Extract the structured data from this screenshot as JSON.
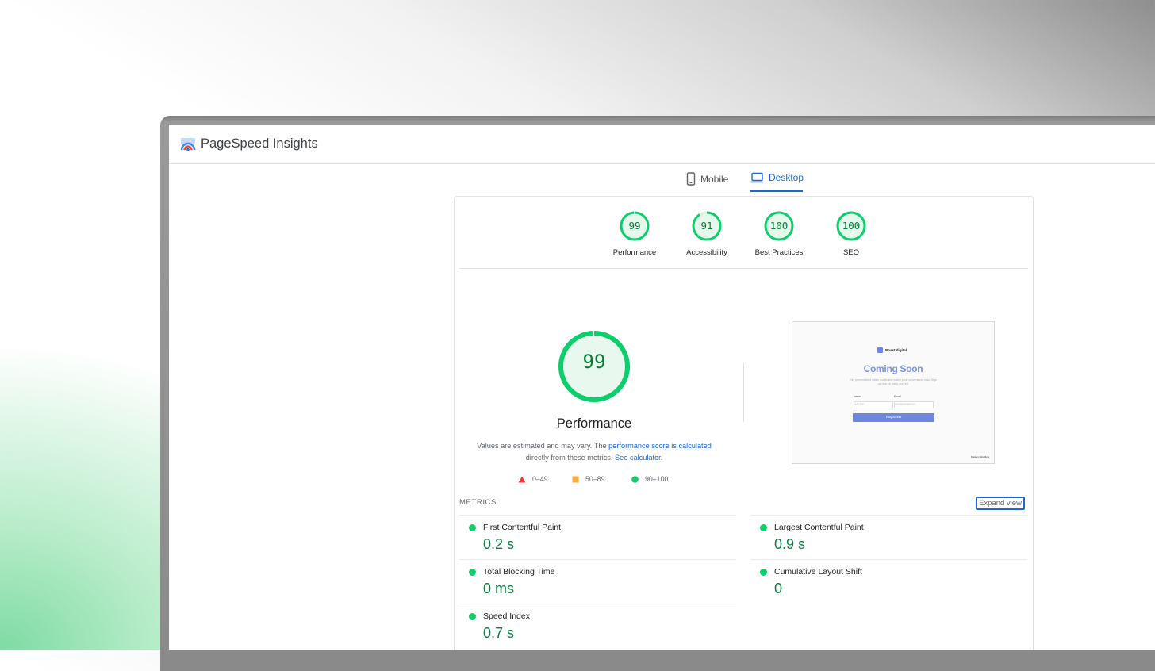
{
  "app": {
    "title": "PageSpeed Insights"
  },
  "tabs": [
    {
      "label": "Mobile",
      "icon": "mobile-phone-icon",
      "active": false
    },
    {
      "label": "Desktop",
      "icon": "desktop-monitor-icon",
      "active": true
    }
  ],
  "scores": [
    {
      "label": "Performance",
      "value": "99",
      "score": 99
    },
    {
      "label": "Accessibility",
      "value": "91",
      "score": 91
    },
    {
      "label": "Best Practices",
      "value": "100",
      "score": 100
    },
    {
      "label": "SEO",
      "value": "100",
      "score": 100
    }
  ],
  "performance": {
    "score": "99",
    "title": "Performance",
    "desc_prefix": "Values are estimated and may vary. The",
    "desc_link1": "performance score is calculated",
    "desc_middle": "directly from these metrics.",
    "desc_link2": "See calculator",
    "desc_suffix": "."
  },
  "legend": [
    {
      "range": "0–49",
      "shape": "triangle",
      "color": "#ff3333"
    },
    {
      "range": "50–89",
      "shape": "square",
      "color": "#ffaa33"
    },
    {
      "range": "90–100",
      "shape": "circle",
      "color": "#0cce6b"
    }
  ],
  "screenshot": {
    "brand": "Roast digital",
    "title": "Coming Soon",
    "subtitle": "Get personalized video audits and watch your conversions soar. Sign up now for early access!",
    "name_label": "Name",
    "name_placeholder": "John Doe",
    "email_label": "Email",
    "email_placeholder": "name@example.com",
    "button": "Early Access",
    "footer": "Made in Webflow"
  },
  "metrics": {
    "label": "METRICS",
    "expand_label": "Expand view",
    "items": [
      {
        "name": "First Contentful Paint",
        "value": "0.2 s"
      },
      {
        "name": "Largest Contentful Paint",
        "value": "0.9 s"
      },
      {
        "name": "Total Blocking Time",
        "value": "0 ms"
      },
      {
        "name": "Cumulative Layout Shift",
        "value": "0"
      },
      {
        "name": "Speed Index",
        "value": "0.7 s"
      }
    ]
  },
  "colors": {
    "pass": "#0cce6b",
    "pass_text": "#0b8043",
    "link": "#1967d2"
  }
}
